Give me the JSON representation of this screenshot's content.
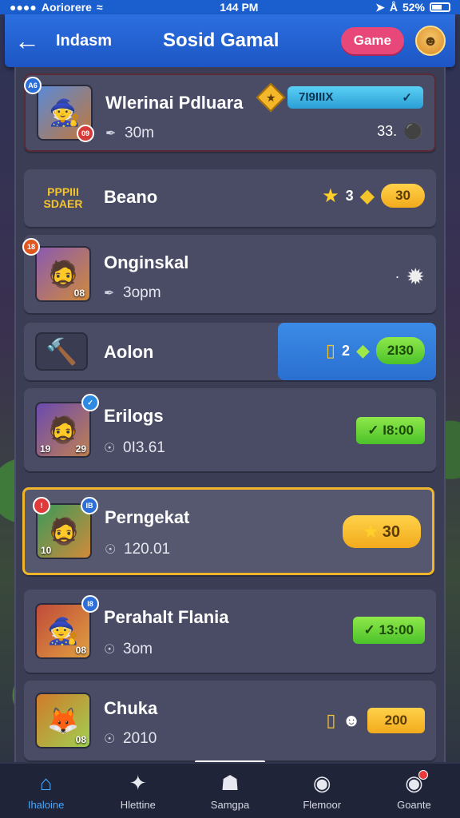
{
  "status_bar": {
    "carrier": "Aoriorere",
    "time": "144 PM",
    "battery": "52%"
  },
  "header": {
    "back_icon": "arrow-left-icon",
    "subtitle": "Indasm",
    "title": "Sosid Gamal",
    "game_button": "Game",
    "avatar_icon": "player-avatar-icon"
  },
  "items": [
    {
      "title": "Wlerinai Pdluara",
      "subtitle": "30m",
      "subtitle_icon": "pen-icon",
      "badge": "A6",
      "thumb_num": "09",
      "pill": "7I9IIIX",
      "right_text": "33.",
      "thumb_icon": "wizard-avatar-icon"
    },
    {
      "title": "Beano",
      "logo_line1": "PPPIII",
      "logo_line2": "SDAER",
      "count": "3",
      "pill": "30"
    },
    {
      "title": "Onginskal",
      "subtitle": "3opm",
      "subtitle_icon": "pen-icon",
      "badge": "18",
      "thumb_num": "08",
      "right_text": "·",
      "thumb_icon": "pirate-avatar-icon"
    },
    {
      "title": "Aolon",
      "count": "2",
      "pill": "2I30",
      "thumb_icon": "hammer-icon"
    },
    {
      "title": "Erilogs",
      "subtitle": "0I3.61",
      "subtitle_icon": "shield-icon",
      "thumb_num_left": "19",
      "thumb_num": "29",
      "pill": "I8:00",
      "thumb_icon": "hero-avatar-icon"
    },
    {
      "title": "Perngekat",
      "subtitle": "120.01",
      "subtitle_icon": "shield-icon",
      "badge": "IB",
      "thumb_num_left": "10",
      "pill": "30",
      "thumb_icon": "adventurer-avatar-icon"
    },
    {
      "title": "Perahalt Flania",
      "subtitle": "3om",
      "subtitle_icon": "shield-icon",
      "badge": "I8",
      "thumb_num": "08",
      "pill": "13:00",
      "thumb_icon": "mage-avatar-icon"
    },
    {
      "title": "Chuka",
      "subtitle": "2010",
      "subtitle_icon": "shield-icon",
      "thumb_num": "08",
      "pill": "200",
      "thumb_icon": "fox-avatar-icon"
    }
  ],
  "tabs": [
    {
      "label": "Ihaloine",
      "icon": "home-icon"
    },
    {
      "label": "Hlettine",
      "icon": "feather-icon"
    },
    {
      "label": "Samgpa",
      "icon": "house-icon"
    },
    {
      "label": "Flemoor",
      "icon": "camera-icon"
    },
    {
      "label": "Goante",
      "icon": "camera-notif-icon"
    }
  ]
}
